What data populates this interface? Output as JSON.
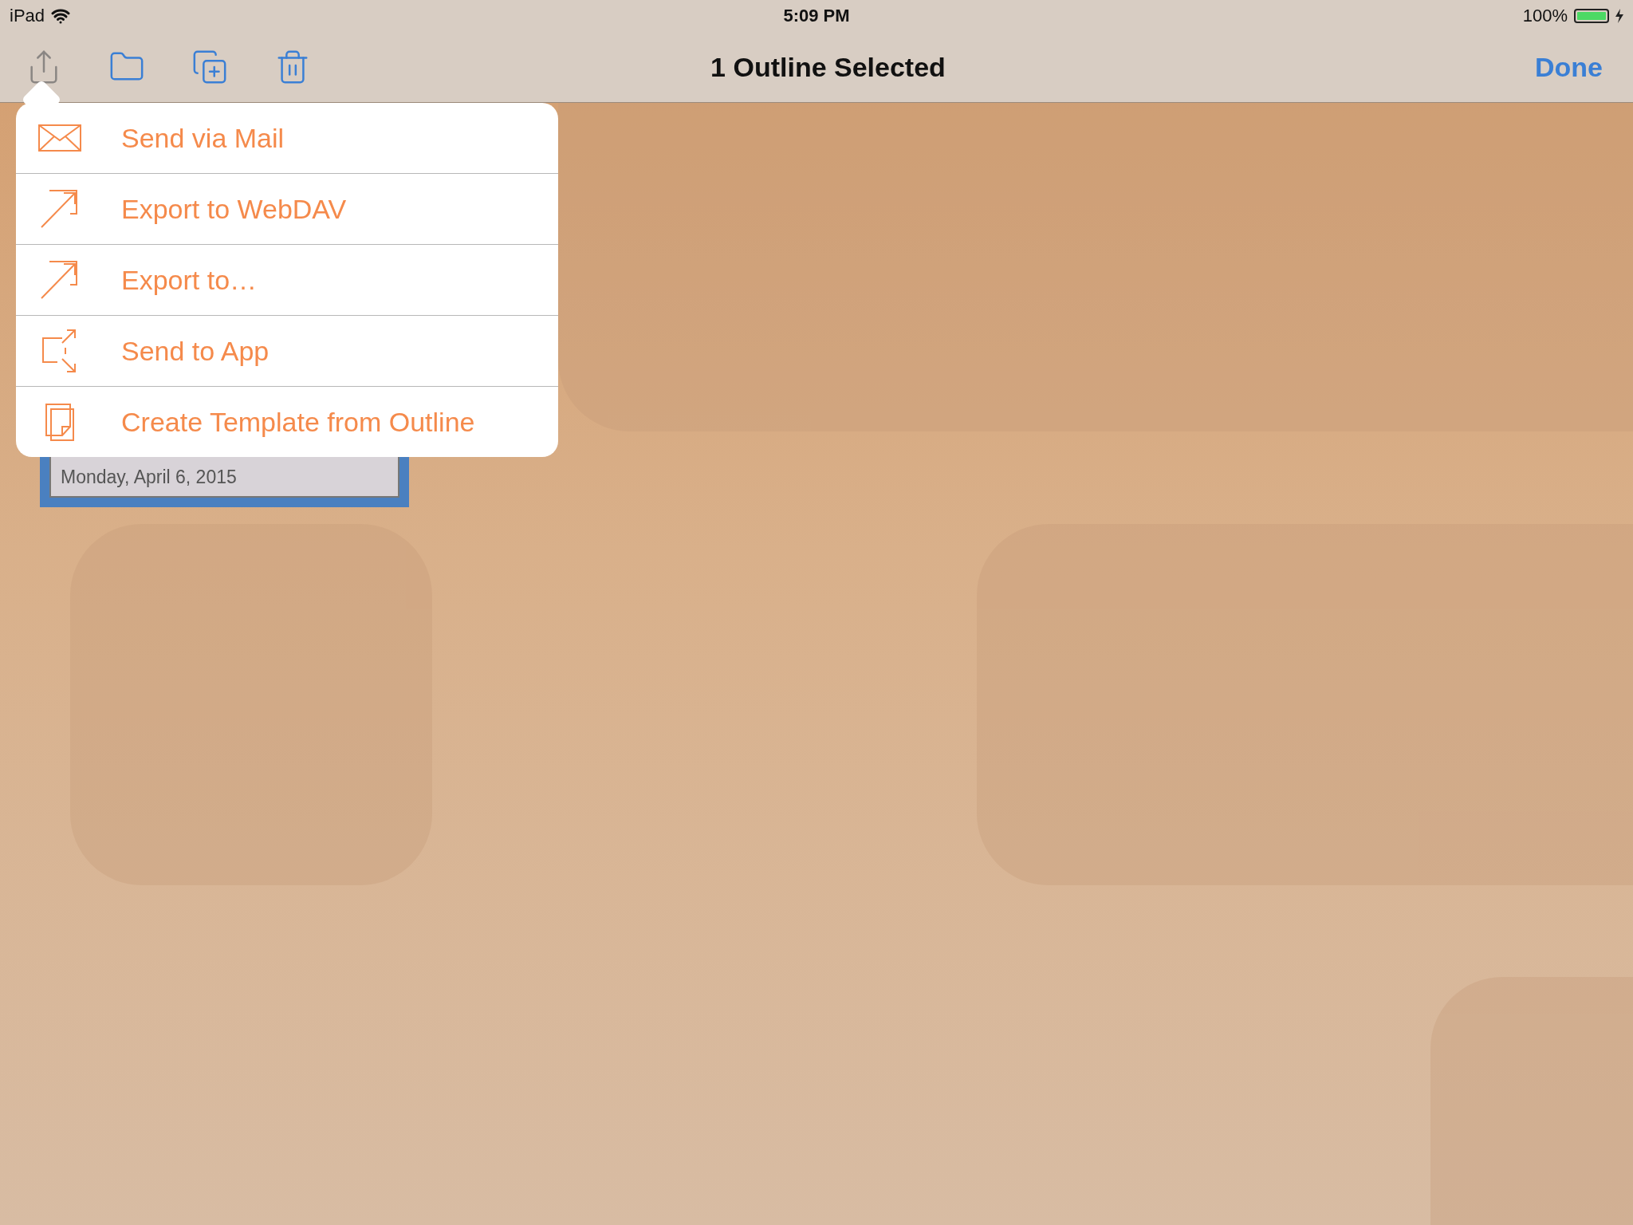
{
  "status_bar": {
    "device": "iPad",
    "time": "5:09 PM",
    "battery": "100%"
  },
  "toolbar": {
    "buttons": [
      {
        "kind": "share",
        "disabled": true
      },
      {
        "kind": "folder",
        "disabled": false
      },
      {
        "kind": "duplicate",
        "disabled": false
      },
      {
        "kind": "trash",
        "disabled": false
      }
    ],
    "title": "1 Outline Selected",
    "done": "Done"
  },
  "menu": {
    "items": [
      {
        "kind": "mail",
        "label": "Send via Mail"
      },
      {
        "kind": "export",
        "label": "Export to WebDAV"
      },
      {
        "kind": "export",
        "label": "Export to…"
      },
      {
        "kind": "app",
        "label": "Send to App"
      },
      {
        "kind": "template",
        "label": "Create Template from Outline"
      }
    ]
  },
  "outline_card": {
    "date": "Monday, April 6, 2015",
    "selected": true
  }
}
